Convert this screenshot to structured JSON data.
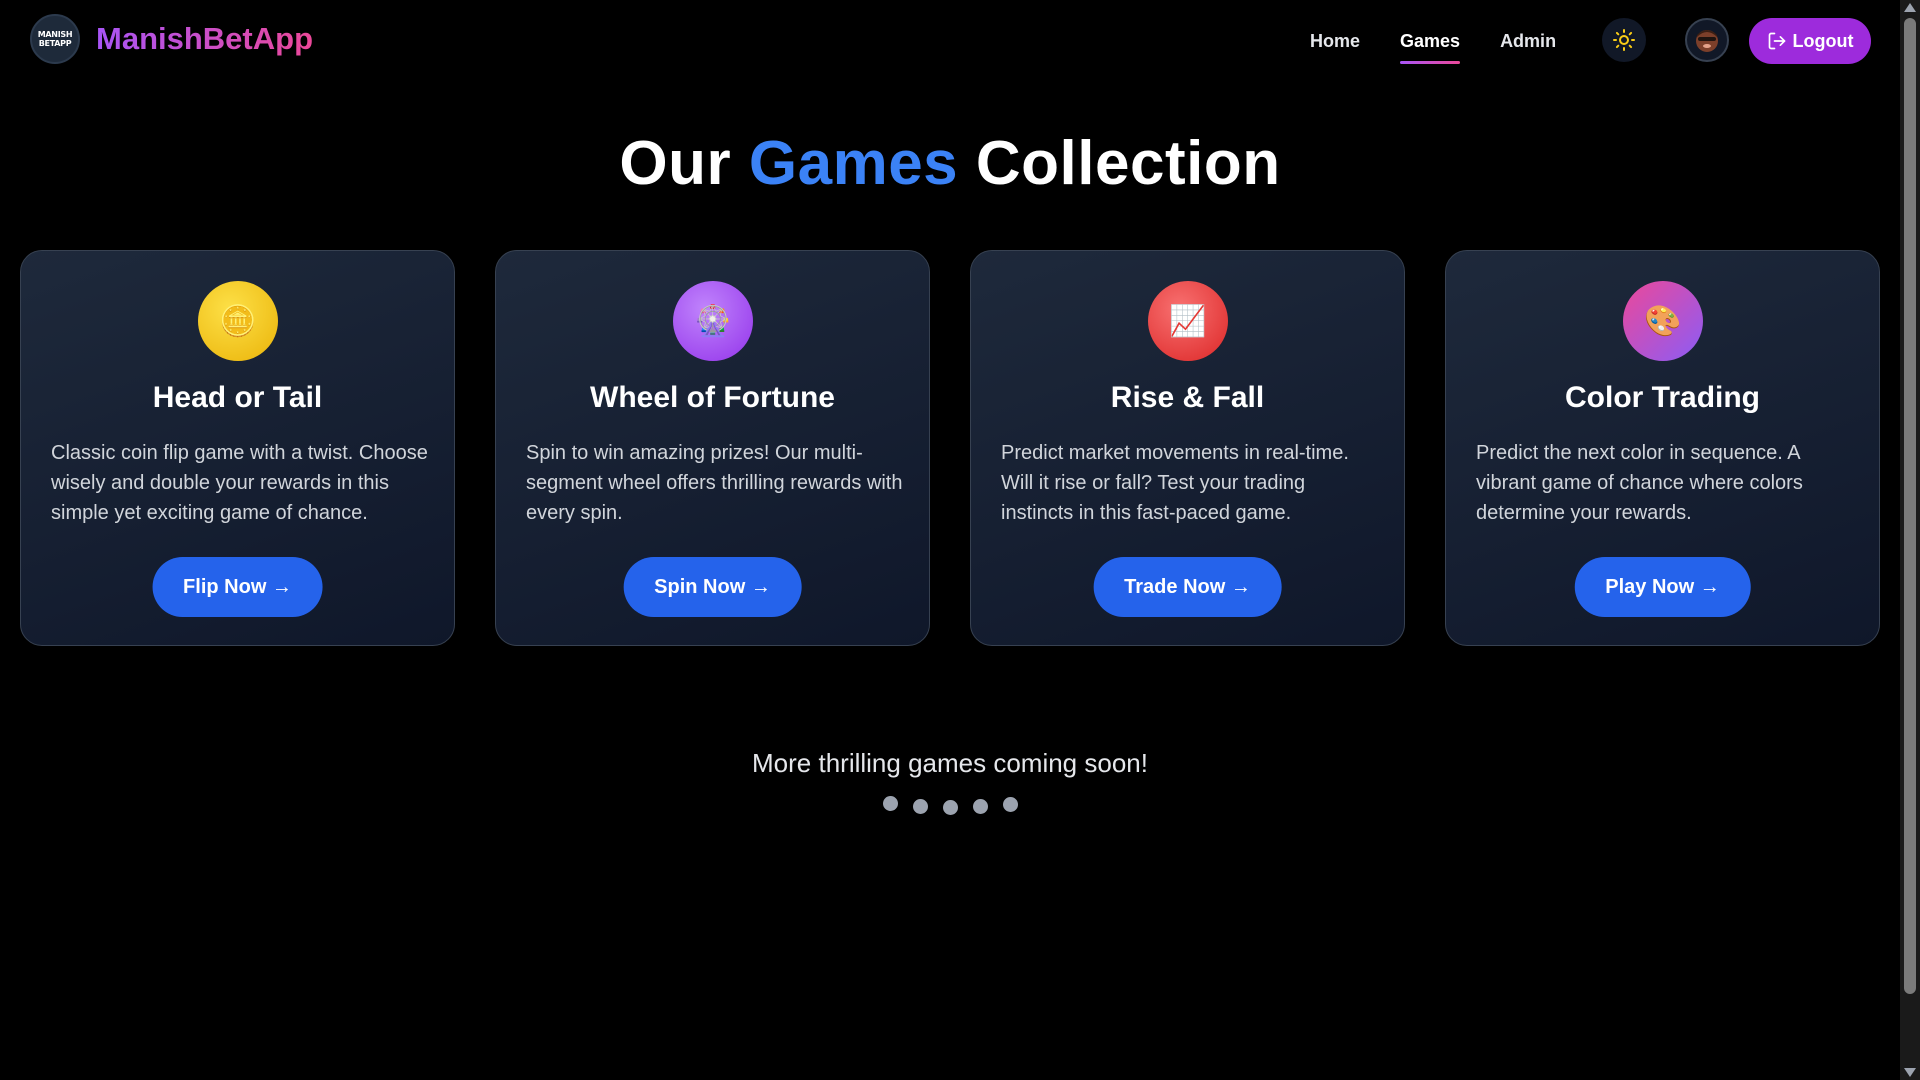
{
  "brand": {
    "logo_line1": "MANISH",
    "logo_line2": "BETAPP",
    "name": "ManishBetApp"
  },
  "nav": {
    "links": [
      {
        "label": "Home",
        "active": false
      },
      {
        "label": "Games",
        "active": true
      },
      {
        "label": "Admin",
        "active": false
      }
    ],
    "theme_icon": "sun-icon",
    "logout_label": "Logout"
  },
  "title": {
    "part1": "Our ",
    "accent": "Games",
    "part2": " Collection"
  },
  "games": [
    {
      "title": "Head or Tail",
      "icon": "coin-icon",
      "icon_glyph": "🪙",
      "icon_bg": "#eab308",
      "description": "Classic coin flip game with a twist. Choose wisely and double your rewards in this simple yet exciting game of chance.",
      "button": "Flip Now →"
    },
    {
      "title": "Wheel of Fortune",
      "icon": "ferris-wheel-icon",
      "icon_glyph": "🎡",
      "icon_bg": "#a855f7",
      "description": "Spin to win amazing prizes! Our multi-segment wheel offers thrilling rewards with every spin.",
      "button": "Spin Now →"
    },
    {
      "title": "Rise & Fall",
      "icon": "chart-up-icon",
      "icon_glyph": "📈",
      "icon_bg": "#ef4444",
      "description": "Predict market movements in real-time. Will it rise or fall? Test your trading instincts in this fast-paced game.",
      "button": "Trade Now →"
    },
    {
      "title": "Color Trading",
      "icon": "palette-icon",
      "icon_glyph": "🎨",
      "icon_bg": "#ec4899",
      "description": "Predict the next color in sequence. A vibrant game of chance where colors determine your rewards.",
      "button": "Play Now →"
    }
  ],
  "coming_soon": "More thrilling games coming soon!",
  "colors": {
    "accent": "#3b82f6",
    "button": "#2563eb",
    "logout": "#9d2bdc"
  }
}
